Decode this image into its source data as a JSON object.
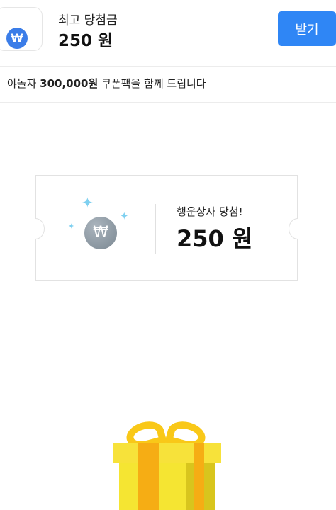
{
  "header": {
    "icon_symbol": "₩",
    "title": "최고 당첨금",
    "amount": "250 원",
    "button_label": "받기",
    "button_color": "#2f86f5"
  },
  "coupon": {
    "prefix": "야놀자 ",
    "amount": "300,000원",
    "suffix": " 쿠폰팩을 함께 드립니다"
  },
  "ticket": {
    "coin_symbol": "₩",
    "label": "행운상자 당첨!",
    "amount": "250 원"
  },
  "icons": {
    "won": "won-coin-icon",
    "sparkle": "sparkle-icon",
    "gift": "gift-box-icon"
  }
}
